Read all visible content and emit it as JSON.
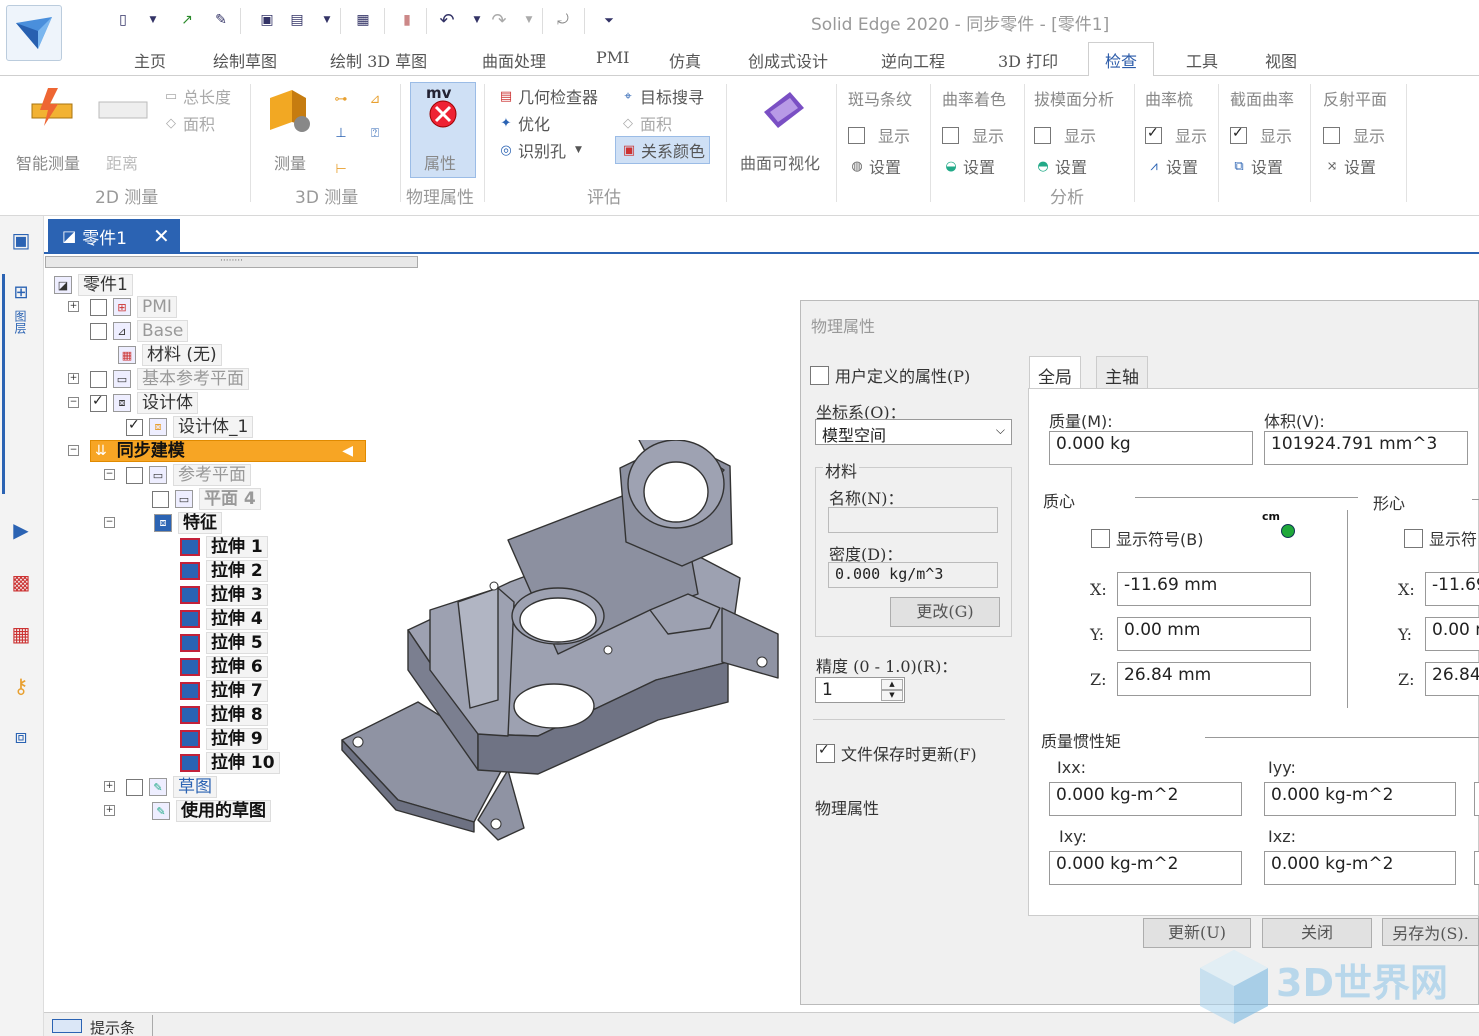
{
  "window": {
    "title": "Solid Edge 2020 - 同步零件 - [零件1]"
  },
  "tabs": [
    {
      "label": "主页"
    },
    {
      "label": "绘制草图"
    },
    {
      "label": "绘制 3D 草图"
    },
    {
      "label": "曲面处理"
    },
    {
      "label": "PMI"
    },
    {
      "label": "仿真"
    },
    {
      "label": "创成式设计"
    },
    {
      "label": "逆向工程"
    },
    {
      "label": "3D 打印"
    },
    {
      "label": "检查"
    },
    {
      "label": "工具"
    },
    {
      "label": "视图"
    }
  ],
  "ribbon": {
    "smart_measure": "智能测量",
    "distance": "距离",
    "total_length": "总长度",
    "area": "面积",
    "group_2d": "2D 测量",
    "measure": "测量",
    "group_3d": "3D 测量",
    "property": "属性",
    "group_phys": "物理属性",
    "geom_checker": "几何检查器",
    "target_search": "目标搜寻",
    "optimize": "优化",
    "area2": "面积",
    "identify_holes": "识别孔",
    "rel_color": "关系颜色",
    "group_eval": "评估",
    "surf_vis": "曲面可视化",
    "zebra": "斑马条纹",
    "curv_shade": "曲率着色",
    "draft": "拔模面分析",
    "curv_comb": "曲率梳",
    "sect_curv": "截面曲率",
    "reflect": "反射平面",
    "show": "显示",
    "settings": "设置",
    "group_analysis": "分析",
    "checks": {
      "zebra": false,
      "curv_shade": false,
      "draft": false,
      "curv_comb": true,
      "sect_curv": true,
      "reflect": false
    }
  },
  "doc_tab": "零件1",
  "tree": {
    "root": "零件1",
    "pmi": "PMI",
    "base": "Base",
    "material": "材料 (无)",
    "ref_planes": "基本参考平面",
    "design_body": "设计体",
    "design_body_1": "设计体_1",
    "sync": "同步建模",
    "ref_plane2": "参考平面",
    "plane4": "平面 4",
    "features": "特征",
    "extrudes": [
      "拉伸 1",
      "拉伸 2",
      "拉伸 3",
      "拉伸 4",
      "拉伸 5",
      "拉伸 6",
      "拉伸 7",
      "拉伸 8",
      "拉伸 9",
      "拉伸 10"
    ],
    "sketch": "草图",
    "used_sketch": "使用的草图"
  },
  "dialog": {
    "title": "物理属性",
    "user_props": "用户定义的属性(P)",
    "coord_label": "坐标系(O)：",
    "coord_value": "模型空间",
    "material_group": "材料",
    "name_label": "名称(N)：",
    "name_value": "",
    "density_label": "密度(D)：",
    "density_value": "0.000 kg/m^3",
    "change_btn": "更改(G)",
    "precision_label": "精度 (0 - 1.0)(R)：",
    "precision_value": "1",
    "update_on_save": "文件保存时更新(F)",
    "phys_label": "物理属性",
    "tab_global": "全局",
    "tab_axis": "主轴",
    "mass_label": "质量(M):",
    "mass_value": "0.000 kg",
    "volume_label": "体积(V):",
    "volume_value": "101924.791 mm^3",
    "cog_label": "质心",
    "centroid_label": "形心",
    "show_symbol": "显示符号(B)",
    "show_symbol2": "显示符",
    "cm_label": "cm",
    "cx": "-11.69 mm",
    "cy": "0.00 mm",
    "cz": "26.84 mm",
    "gx": "-11.69",
    "gy": "0.00 r",
    "gz": "26.84",
    "x": "X:",
    "y": "Y:",
    "z": "Z:",
    "inertia_label": "质量惯性矩",
    "ixx_label": "Ixx:",
    "ixx": "0.000 kg-m^2",
    "iyy_label": "Iyy:",
    "iyy": "0.000 kg-m^2",
    "ixy_label": "Ixy:",
    "ixy": "0.000 kg-m^2",
    "ixz_label": "Ixz:",
    "ixz": "0.000 kg-m^2",
    "update_btn": "更新(U)",
    "close_btn": "关闭",
    "save_as_btn": "另存为(S)."
  },
  "status": {
    "label": "提示条"
  },
  "watermark": "3D世界网"
}
